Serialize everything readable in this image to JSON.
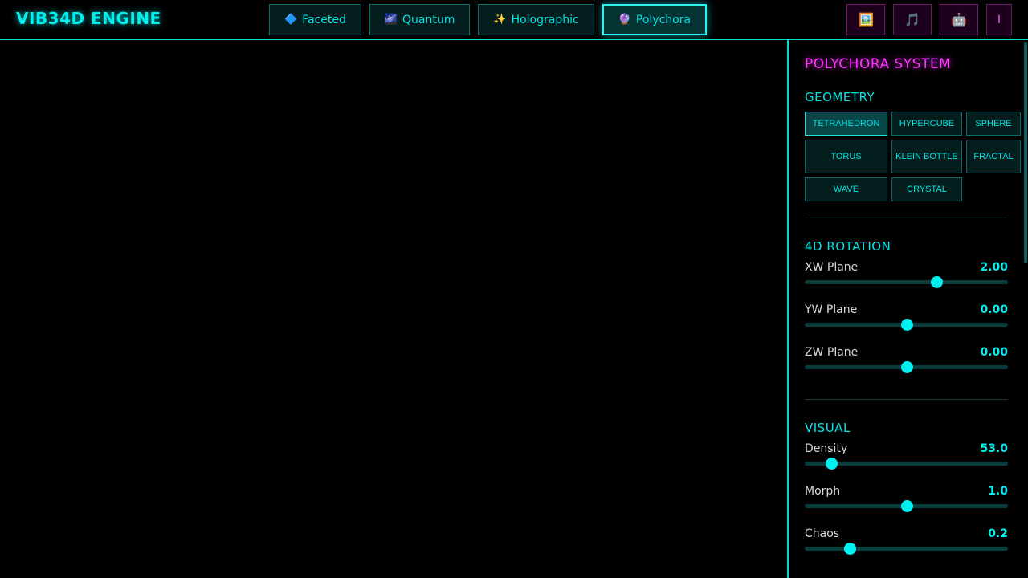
{
  "header": {
    "logo": "VIB34D ENGINE",
    "systems": [
      {
        "icon": "🔷",
        "label": "Faceted",
        "active": false
      },
      {
        "icon": "🌌",
        "label": "Quantum",
        "active": false
      },
      {
        "icon": "✨",
        "label": "Holographic",
        "active": false
      },
      {
        "icon": "🔮",
        "label": "Polychora",
        "active": true
      }
    ],
    "tools": [
      {
        "icon": "🖼️",
        "name": "gallery-icon"
      },
      {
        "icon": "🎵",
        "name": "audio-icon"
      },
      {
        "icon": "🤖",
        "name": "ai-icon"
      },
      {
        "icon": "I",
        "name": "info-icon"
      }
    ]
  },
  "panel": {
    "title": "POLYCHORA SYSTEM",
    "geometry": {
      "title": "GEOMETRY",
      "options": [
        "TETRAHEDRON",
        "HYPERCUBE",
        "SPHERE",
        "TORUS",
        "KLEIN BOTTLE",
        "FRACTAL",
        "WAVE",
        "CRYSTAL"
      ],
      "selected": "TETRAHEDRON"
    },
    "rotation": {
      "title": "4D ROTATION",
      "sliders": [
        {
          "label": "XW Plane",
          "value": "2.00",
          "fraction": 0.65
        },
        {
          "label": "YW Plane",
          "value": "0.00",
          "fraction": 0.5
        },
        {
          "label": "ZW Plane",
          "value": "0.00",
          "fraction": 0.5
        }
      ]
    },
    "visual": {
      "title": "VISUAL",
      "sliders": [
        {
          "label": "Density",
          "value": "53.0",
          "fraction": 0.13
        },
        {
          "label": "Morph",
          "value": "1.0",
          "fraction": 0.5
        },
        {
          "label": "Chaos",
          "value": "0.2",
          "fraction": 0.22
        }
      ]
    }
  },
  "colors": {
    "accent": "#00e5e5",
    "accent_glow": "#2cf0f0",
    "magenta": "#ff33ff",
    "background": "#000000"
  }
}
